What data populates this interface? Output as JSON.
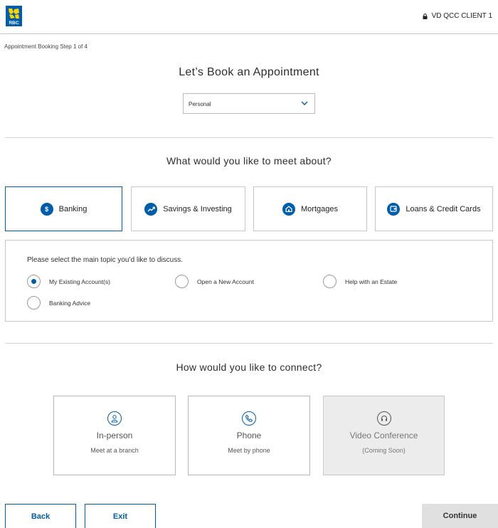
{
  "header": {
    "logo_text": "RBC",
    "user_label": "VD QCC CLIENT 1"
  },
  "step_label": "Appointment Booking Step 1 of 4",
  "booking": {
    "title": "Let’s Book an Appointment",
    "type_selected": "Personal"
  },
  "topics": {
    "title": "What would you like to meet about?",
    "items": [
      {
        "label": "Banking",
        "icon": "dollar-icon",
        "selected": true
      },
      {
        "label": "Savings & Investing",
        "icon": "trend-up-icon",
        "selected": false
      },
      {
        "label": "Mortgages",
        "icon": "house-icon",
        "selected": false
      },
      {
        "label": "Loans & Credit Cards",
        "icon": "card-icon",
        "selected": false
      }
    ]
  },
  "subtopics": {
    "prompt": "Please select the main topic you’d like to discuss.",
    "options": [
      {
        "label": "My Existing Account(s)",
        "selected": true
      },
      {
        "label": "Open a New Account",
        "selected": false
      },
      {
        "label": "Help with an Estate",
        "selected": false
      },
      {
        "label": "Banking Advice",
        "selected": false
      }
    ]
  },
  "connect": {
    "title": "How would you like to connect?",
    "options": [
      {
        "title": "In-person",
        "subtitle": "Meet at a branch",
        "icon": "person-icon",
        "disabled": false
      },
      {
        "title": "Phone",
        "subtitle": "Meet by phone",
        "icon": "phone-icon",
        "disabled": false
      },
      {
        "title": "Video Conference",
        "subtitle": "(Coming Soon)",
        "icon": "headset-icon",
        "disabled": true
      }
    ]
  },
  "actions": {
    "back": "Back",
    "exit": "Exit",
    "continue": "Continue"
  },
  "colors": {
    "brand_blue": "#005daa",
    "brand_yellow": "#ffd200"
  }
}
